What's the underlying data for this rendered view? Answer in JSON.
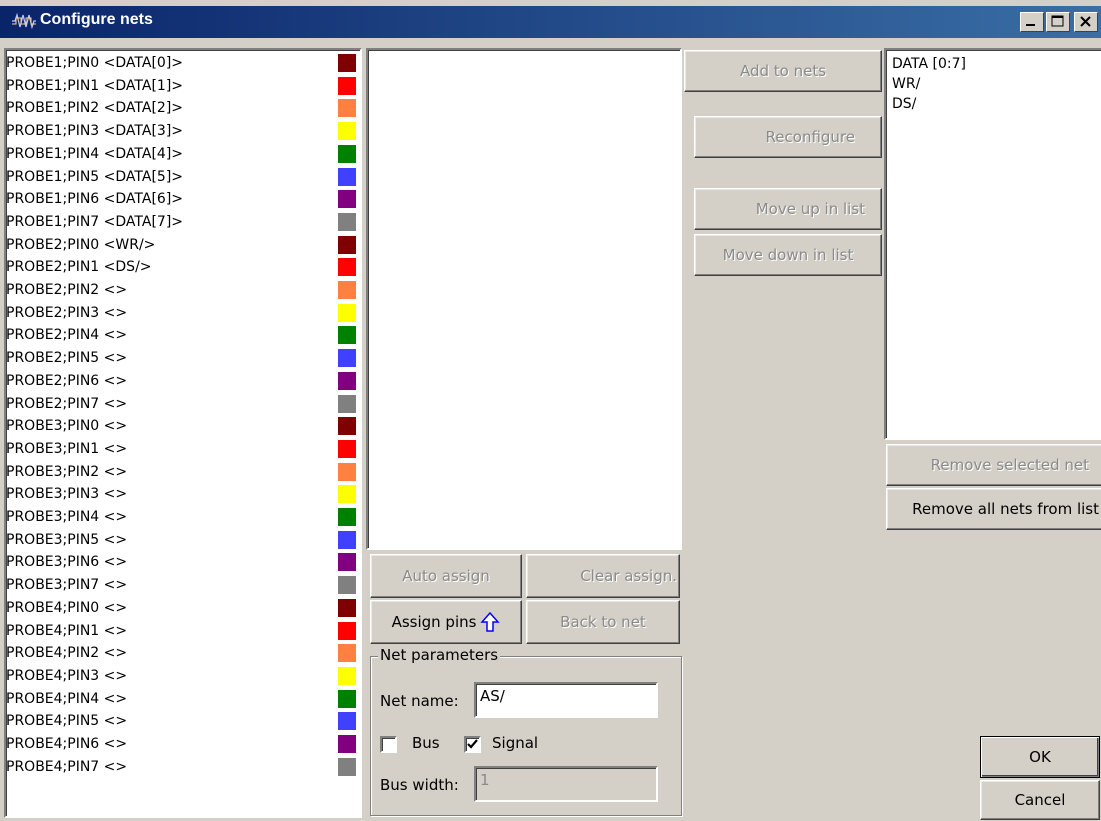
{
  "window": {
    "title": "Configure nets"
  },
  "pins": [
    {
      "label": "PROBE1;PIN0 <DATA[0]>",
      "color": "#800000"
    },
    {
      "label": "PROBE1;PIN1 <DATA[1]>",
      "color": "#ff0000"
    },
    {
      "label": "PROBE1;PIN2 <DATA[2]>",
      "color": "#ff8040"
    },
    {
      "label": "PROBE1;PIN3 <DATA[3]>",
      "color": "#ffff00"
    },
    {
      "label": "PROBE1;PIN4 <DATA[4]>",
      "color": "#008000"
    },
    {
      "label": "PROBE1;PIN5 <DATA[5]>",
      "color": "#4040ff"
    },
    {
      "label": "PROBE1;PIN6 <DATA[6]>",
      "color": "#800080"
    },
    {
      "label": "PROBE1;PIN7 <DATA[7]>",
      "color": "#808080"
    },
    {
      "label": "PROBE2;PIN0 <WR/>",
      "color": "#800000"
    },
    {
      "label": "PROBE2;PIN1 <DS/>",
      "color": "#ff0000"
    },
    {
      "label": "PROBE2;PIN2 <>",
      "color": "#ff8040"
    },
    {
      "label": "PROBE2;PIN3 <>",
      "color": "#ffff00"
    },
    {
      "label": "PROBE2;PIN4 <>",
      "color": "#008000"
    },
    {
      "label": "PROBE2;PIN5 <>",
      "color": "#4040ff"
    },
    {
      "label": "PROBE2;PIN6 <>",
      "color": "#800080"
    },
    {
      "label": "PROBE2;PIN7 <>",
      "color": "#808080"
    },
    {
      "label": "PROBE3;PIN0 <>",
      "color": "#800000"
    },
    {
      "label": "PROBE3;PIN1 <>",
      "color": "#ff0000"
    },
    {
      "label": "PROBE3;PIN2 <>",
      "color": "#ff8040"
    },
    {
      "label": "PROBE3;PIN3 <>",
      "color": "#ffff00"
    },
    {
      "label": "PROBE3;PIN4 <>",
      "color": "#008000"
    },
    {
      "label": "PROBE3;PIN5 <>",
      "color": "#4040ff"
    },
    {
      "label": "PROBE3;PIN6 <>",
      "color": "#800080"
    },
    {
      "label": "PROBE3;PIN7 <>",
      "color": "#808080"
    },
    {
      "label": "PROBE4;PIN0 <>",
      "color": "#800000"
    },
    {
      "label": "PROBE4;PIN1 <>",
      "color": "#ff0000"
    },
    {
      "label": "PROBE4;PIN2 <>",
      "color": "#ff8040"
    },
    {
      "label": "PROBE4;PIN3 <>",
      "color": "#ffff00"
    },
    {
      "label": "PROBE4;PIN4 <>",
      "color": "#008000"
    },
    {
      "label": "PROBE4;PIN5 <>",
      "color": "#4040ff"
    },
    {
      "label": "PROBE4;PIN6 <>",
      "color": "#800080"
    },
    {
      "label": "PROBE4;PIN7 <>",
      "color": "#808080"
    }
  ],
  "nets": [
    "DATA [0:7]",
    "WR/",
    "DS/"
  ],
  "buttons": {
    "add_to_nets": "Add to nets",
    "reconfigure": "Reconfigure",
    "move_up": "Move up in list",
    "move_down": "Move down in list",
    "remove_selected": "Remove selected net",
    "remove_all": "Remove all nets from list",
    "auto_assign": "Auto assign",
    "clear_assign": "Clear assign.",
    "assign_pins": "Assign pins",
    "back_to_net": "Back to net",
    "ok": "OK",
    "cancel": "Cancel"
  },
  "net_parameters": {
    "legend": "Net parameters",
    "net_name_label": "Net name:",
    "net_name_value": "AS/",
    "bus_label": "Bus",
    "bus_checked": false,
    "signal_label": "Signal",
    "signal_checked": true,
    "bus_width_label": "Bus width:",
    "bus_width_value": "1"
  }
}
